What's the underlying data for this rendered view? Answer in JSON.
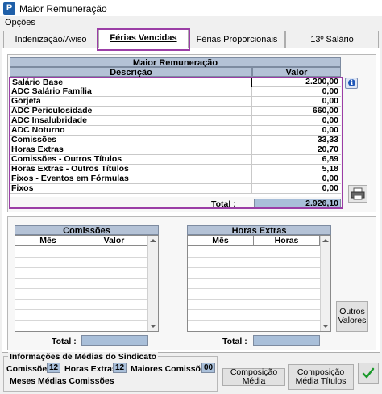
{
  "window": {
    "title": "Maior Remuneração",
    "app_icon_letter": "P"
  },
  "menu": {
    "opcoes": "Opções"
  },
  "tabs": [
    {
      "label": "Indenização/Aviso Prévio"
    },
    {
      "label": "Férias Vencidas"
    },
    {
      "label": "Férias Proporcionais"
    },
    {
      "label": "13º Salário"
    }
  ],
  "main_table": {
    "title": "Maior Remuneração",
    "col_desc": "Descrição",
    "col_val": "Valor",
    "rows": [
      {
        "desc": "Salário Base",
        "val": "2.200,00"
      },
      {
        "desc": "ADC Salário Família",
        "val": "0,00"
      },
      {
        "desc": "Gorjeta",
        "val": "0,00"
      },
      {
        "desc": "ADC Periculosidade",
        "val": "660,00"
      },
      {
        "desc": "ADC Insalubridade",
        "val": "0,00"
      },
      {
        "desc": "ADC Noturno",
        "val": "0,00"
      },
      {
        "desc": "Comissões",
        "val": "33,33"
      },
      {
        "desc": "Horas Extras",
        "val": "20,70"
      },
      {
        "desc": "Comissões - Outros Títulos",
        "val": "6,89"
      },
      {
        "desc": "Horas Extras - Outros Títulos",
        "val": "5,18"
      },
      {
        "desc": "Fixos - Eventos em Fórmulas",
        "val": "0,00"
      },
      {
        "desc": "Fixos",
        "val": "0,00"
      }
    ],
    "total_label": "Total :",
    "total_value": "2.926,10"
  },
  "comissoes": {
    "title": "Comissões",
    "col_mes": "Mês",
    "col_valor": "Valor",
    "total_label": "Total :"
  },
  "horas_extras": {
    "title": "Horas Extras",
    "col_mes": "Mês",
    "col_horas": "Horas",
    "total_label": "Total :"
  },
  "buttons": {
    "outros_valores": "Outros Valores",
    "composicao_media": "Composição Média",
    "composicao_media_titulos": "Composição Média Títulos"
  },
  "sindicato": {
    "title": "Informações de Médias do Sindicato",
    "comissoes_label": "Comissões",
    "comissoes_val": "12",
    "horas_extras_label": "Horas Extras",
    "horas_extras_val": "12",
    "maiores_comissoes_label": "Maiores Comissões",
    "maiores_comissoes_val": "00",
    "meses_medias_label": "Meses Médias Comissões"
  },
  "colors": {
    "highlight": "#9b3ea6",
    "header_blue": "#b4c2d6",
    "value_box": "#a9bfd9"
  }
}
